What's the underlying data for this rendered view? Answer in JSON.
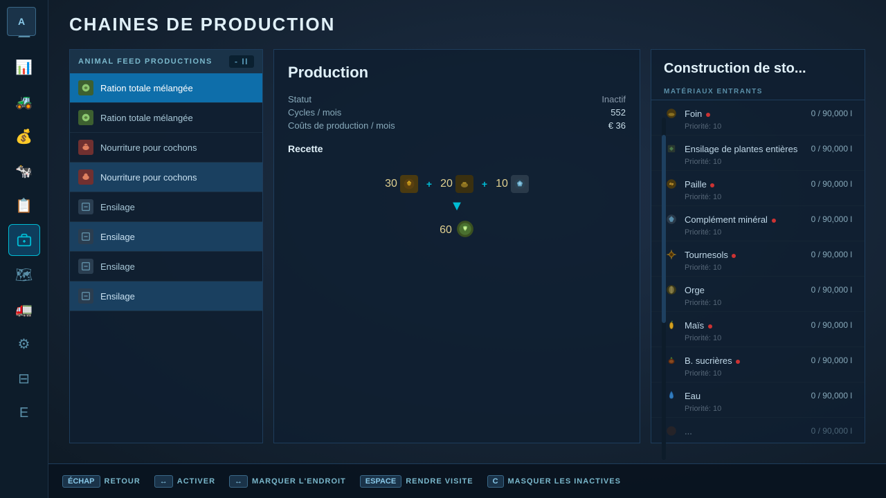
{
  "page": {
    "title": "CHAINES DE PRODUCTION",
    "corner_button": "A"
  },
  "sidebar": {
    "items": [
      {
        "id": "weather",
        "icon": "☁",
        "active": false
      },
      {
        "id": "stats",
        "icon": "📊",
        "active": false
      },
      {
        "id": "tractor",
        "icon": "🚜",
        "active": false
      },
      {
        "id": "money",
        "icon": "💰",
        "active": false
      },
      {
        "id": "animals",
        "icon": "🐄",
        "active": false
      },
      {
        "id": "tasks",
        "icon": "📋",
        "active": false
      },
      {
        "id": "production",
        "icon": "⚙",
        "active": true
      },
      {
        "id": "map",
        "icon": "🗺",
        "active": false
      },
      {
        "id": "vehicles",
        "icon": "🚛",
        "active": false
      },
      {
        "id": "settings",
        "icon": "⚙",
        "active": false
      },
      {
        "id": "sliders",
        "icon": "⊟",
        "active": false
      },
      {
        "id": "e",
        "icon": "E",
        "active": false
      }
    ]
  },
  "chain_panel": {
    "header_name": "ANIMAL FEED PRODUCTIONS",
    "header_number": "II",
    "items": [
      {
        "id": 1,
        "name": "Ration totale mélangée",
        "icon_type": "feed",
        "icon": "🌾",
        "selected": true
      },
      {
        "id": 2,
        "name": "Ration totale mélangée",
        "icon_type": "feed",
        "icon": "🌾",
        "selected": false
      },
      {
        "id": 3,
        "name": "Nourriture pour cochons",
        "icon_type": "pig",
        "icon": "🐷",
        "selected": false
      },
      {
        "id": 4,
        "name": "Nourriture pour cochons",
        "icon_type": "pig",
        "icon": "🐷",
        "selected": false,
        "alt": true
      },
      {
        "id": 5,
        "name": "Ensilage",
        "icon_type": "ensilage",
        "icon": "🌿",
        "selected": false
      },
      {
        "id": 6,
        "name": "Ensilage",
        "icon_type": "ensilage",
        "icon": "🌿",
        "selected": false,
        "alt": true
      },
      {
        "id": 7,
        "name": "Ensilage",
        "icon_type": "ensilage",
        "icon": "🌿",
        "selected": false
      },
      {
        "id": 8,
        "name": "Ensilage",
        "icon_type": "ensilage",
        "icon": "🌿",
        "selected": false,
        "alt": true
      }
    ]
  },
  "production": {
    "title": "Production",
    "statut_label": "Statut",
    "statut_value": "Inactif",
    "cycles_label": "Cycles / mois",
    "cycles_value": "552",
    "couts_label": "Coûts de production / mois",
    "couts_value": "€ 36",
    "recette_label": "Recette",
    "recipe": {
      "inputs": [
        {
          "amount": "30",
          "icon_type": "wheat",
          "icon": "🌾"
        },
        {
          "amount": "20",
          "icon_type": "hay",
          "icon": "🌿"
        },
        {
          "amount": "10",
          "icon_type": "mineral",
          "icon": "💊"
        }
      ],
      "output_amount": "60",
      "output_icon": "🥗"
    }
  },
  "storage": {
    "title": "Construction de sto...",
    "materials_header": "MATÉRIAUX ENTRANTS",
    "items": [
      {
        "name": "Foin",
        "amount": "0 / 90,000 l",
        "priority": "Priorité: 10",
        "icon": "🌾",
        "has_dot": true
      },
      {
        "name": "Ensilage de plantes entières",
        "amount": "0 / 90,000 l",
        "priority": "Priorité: 10",
        "icon": "🌿",
        "has_dot": false
      },
      {
        "name": "Paille",
        "amount": "0 / 90,000 l",
        "priority": "Priorité: 10",
        "icon": "🌾",
        "has_dot": true
      },
      {
        "name": "Complément minéral",
        "amount": "0 / 90,000 l",
        "priority": "Priorité: 10",
        "icon": "⚗",
        "has_dot": true
      },
      {
        "name": "Tournesols",
        "amount": "0 / 90,000 l",
        "priority": "Priorité: 10",
        "icon": "🌻",
        "has_dot": true
      },
      {
        "name": "Orge",
        "amount": "0 / 90,000 l",
        "priority": "Priorité: 10",
        "icon": "🌾",
        "has_dot": false
      },
      {
        "name": "Maïs",
        "amount": "0 / 90,000 l",
        "priority": "Priorité: 10",
        "icon": "🌽",
        "has_dot": true
      },
      {
        "name": "B. sucrières",
        "amount": "0 / 90,000 l",
        "priority": "Priorité: 10",
        "icon": "🥔",
        "has_dot": true
      },
      {
        "name": "Eau",
        "amount": "0 / 90,000 l",
        "priority": "Priorité: 10",
        "icon": "💧",
        "has_dot": false
      }
    ]
  },
  "toolbar": {
    "actions": [
      {
        "key": "ÉCHAP",
        "label": "RETOUR"
      },
      {
        "key": "↔",
        "label": "ACTIVER"
      },
      {
        "key": "↔",
        "label": "MARQUER L'ENDROIT"
      },
      {
        "key": "ESPACE",
        "label": "RENDRE VISITE"
      },
      {
        "key": "C",
        "label": "MASQUER LES INACTIVES"
      }
    ]
  }
}
